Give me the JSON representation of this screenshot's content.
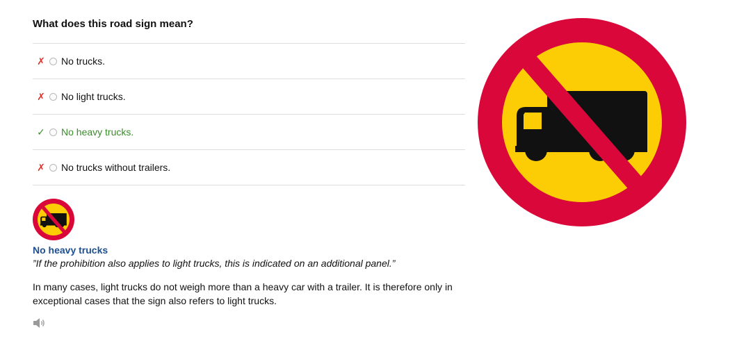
{
  "question": {
    "text": "What does this road sign mean?"
  },
  "answers": [
    {
      "mark": "✗",
      "label": "No trucks.",
      "correct": false
    },
    {
      "mark": "✗",
      "label": "No light trucks.",
      "correct": false
    },
    {
      "mark": "✓",
      "label": "No heavy trucks.",
      "correct": true
    },
    {
      "mark": "✗",
      "label": "No trucks without trailers.",
      "correct": false
    }
  ],
  "explanation": {
    "title": "No heavy trucks",
    "quote": "”If the prohibition also applies to light trucks, this is indicated on an additional panel.”",
    "body": "In many cases, light trucks do not weigh more than a heavy car with a trailer. It is therefore only in exceptional cases that the sign also refers to light trucks."
  },
  "audio": {
    "icon": "speaker-icon"
  },
  "sign": {
    "icon": "no-heavy-trucks-sign",
    "ring_color": "#d9073a",
    "fill_color": "#fccd05",
    "truck_color": "#111111"
  },
  "colors": {
    "correct": "#3a8c2a",
    "wrong": "#e0302a",
    "title": "#1d4f91"
  }
}
